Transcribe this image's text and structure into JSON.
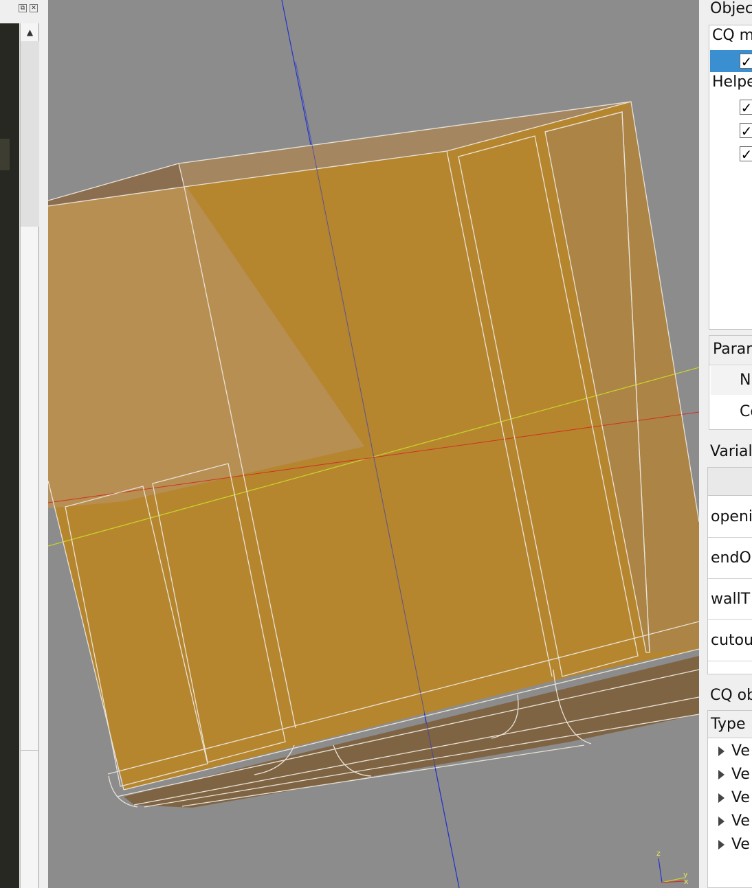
{
  "left_panel": {
    "float_icon": "float-icon",
    "close_icon": "close-icon",
    "scroll_up_icon": "triangle-up-icon"
  },
  "viewport": {
    "background": "#8c8c8c",
    "model_color": "#b8862a",
    "triad_labels": {
      "z": "z",
      "y": "y",
      "x": "x"
    }
  },
  "objects_panel": {
    "title": "Objec",
    "groups": [
      {
        "label": "CQ m",
        "items": [
          {
            "checked": "✓",
            "selected": true
          }
        ]
      },
      {
        "label": "Helpe",
        "items": [
          {
            "checked": "✓"
          },
          {
            "checked": "✓"
          },
          {
            "checked": "✓"
          }
        ]
      }
    ]
  },
  "params_panel": {
    "title": "Parar",
    "rows": [
      {
        "label": "N"
      },
      {
        "label": "Co"
      }
    ]
  },
  "variables_panel": {
    "title": "Varial",
    "rows": [
      {
        "label": "openi"
      },
      {
        "label": "endO"
      },
      {
        "label": "wallT"
      },
      {
        "label": "cutou"
      }
    ]
  },
  "cq_object_panel": {
    "title": "CQ ob",
    "header": "Type",
    "rows": [
      {
        "label": "Ve"
      },
      {
        "label": "Ve"
      },
      {
        "label": "Ve"
      },
      {
        "label": "Ve"
      },
      {
        "label": "Ve"
      }
    ]
  }
}
